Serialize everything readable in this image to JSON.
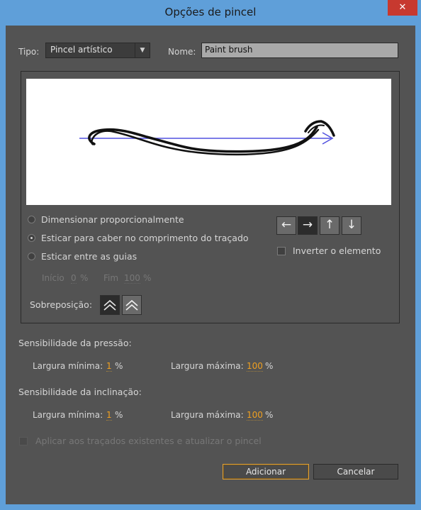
{
  "window": {
    "title": "Opções de pincel",
    "close_label": "✕"
  },
  "tipo": {
    "label": "Tipo:",
    "value": "Pincel artístico"
  },
  "nome": {
    "label": "Nome:",
    "value": "Paint brush"
  },
  "options": {
    "proportional": "Dimensionar proporcionalmente",
    "stretch": "Esticar para caber no comprimento do traçado",
    "guides": "Esticar entre as guias",
    "selected": "stretch"
  },
  "guides": {
    "start_label": "Início",
    "start_value": "0",
    "end_label": "Fim",
    "end_value": "100",
    "unit": "%"
  },
  "direction": {
    "left": "←",
    "right": "→",
    "up": "↑",
    "down": "↓",
    "selected": "right"
  },
  "flip": {
    "label": "Inverter o elemento",
    "checked": false
  },
  "overlap": {
    "label": "Sobreposição:"
  },
  "pressure": {
    "title": "Sensibilidade da pressão:",
    "min_label": "Largura mínima:",
    "min_value": "1",
    "max_label": "Largura máxima:",
    "max_value": "100",
    "unit": "%"
  },
  "tilt": {
    "title": "Sensibilidade da inclinação:",
    "min_label": "Largura mínima:",
    "min_value": "1",
    "max_label": "Largura máxima:",
    "max_value": "100",
    "unit": "%"
  },
  "apply": {
    "label": "Aplicar aos traçados existentes e atualizar o pincel",
    "checked": false
  },
  "buttons": {
    "add": "Adicionar",
    "cancel": "Cancelar"
  },
  "colors": {
    "accent": "#f0a020",
    "guide_line": "#5050e0",
    "titlebar": "#5f9fd9"
  }
}
